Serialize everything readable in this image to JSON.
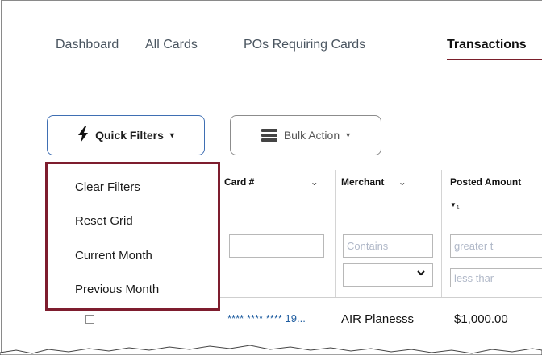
{
  "nav": {
    "tabs": [
      {
        "label": "Dashboard",
        "active": false
      },
      {
        "label": "All Cards",
        "active": false
      },
      {
        "label": "POs Requiring Cards",
        "active": false
      },
      {
        "label": "Transactions",
        "active": true
      }
    ]
  },
  "toolbar": {
    "quick_filters_label": "Quick Filters",
    "quick_filters_icon": "lightning-bolt-icon",
    "bulk_action_label": "Bulk Action",
    "bulk_action_icon": "stack-icon"
  },
  "quick_filters_menu": {
    "items": [
      "Clear Filters",
      "Reset Grid",
      "Current Month",
      "Previous Month"
    ]
  },
  "grid": {
    "columns": [
      {
        "label": "Card #"
      },
      {
        "label": "Merchant"
      },
      {
        "label": "Posted Amount",
        "sort_index": "1",
        "sort_direction": "descending"
      }
    ],
    "filters": {
      "card_value": "",
      "merchant_placeholder": "Contains",
      "amount_min_placeholder": "greater t",
      "amount_max_placeholder": "less thar"
    },
    "rows": [
      {
        "card": "**** **** **** 19...",
        "merchant": "AIR Planesss",
        "amount": "$1,000.00",
        "selected": false
      }
    ]
  },
  "colors": {
    "accent_maroon": "#7e1d2e",
    "primary_blue": "#3f6fb3",
    "link_blue": "#1f5da0"
  }
}
